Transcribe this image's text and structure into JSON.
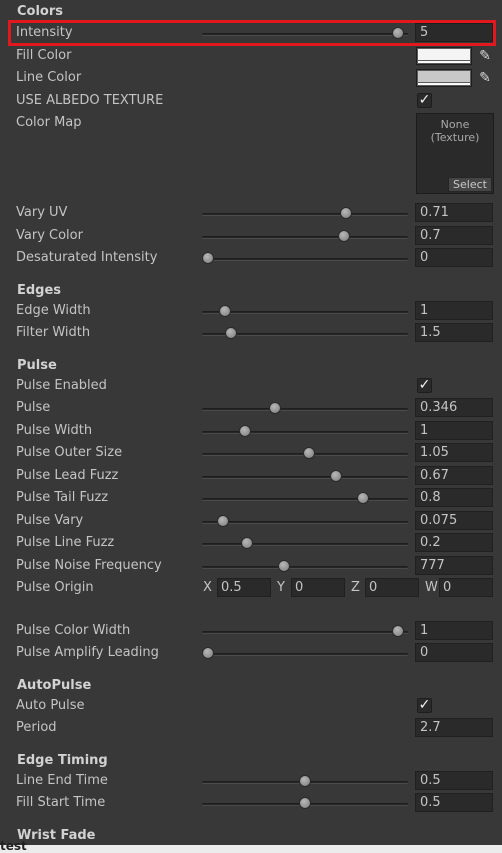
{
  "sections": {
    "colors": "Colors",
    "edges": "Edges",
    "pulse": "Pulse",
    "autopulse": "AutoPulse",
    "edge_timing": "Edge Timing",
    "wrist_fade": "Wrist Fade"
  },
  "colors": {
    "intensity": {
      "label": "Intensity",
      "value": "5",
      "fraction": 0.98
    },
    "fill_color": {
      "label": "Fill Color",
      "color": "#f4f4f4"
    },
    "line_color": {
      "label": "Line Color",
      "color": "#c8c8c8"
    },
    "use_albedo": {
      "label": "USE ALBEDO TEXTURE",
      "checked": "✓"
    },
    "color_map": {
      "label": "Color Map",
      "none_text": "None\n(Texture)",
      "select_label": "Select"
    },
    "vary_uv": {
      "label": "Vary UV",
      "value": "0.71",
      "fraction": 0.71
    },
    "vary_color": {
      "label": "Vary Color",
      "value": "0.7",
      "fraction": 0.7
    },
    "desaturated_intensity": {
      "label": "Desaturated Intensity",
      "value": "0",
      "fraction": 0.0
    }
  },
  "edges": {
    "edge_width": {
      "label": "Edge Width",
      "value": "1",
      "fraction": 0.09
    },
    "filter_width": {
      "label": "Filter Width",
      "value": "1.5",
      "fraction": 0.12
    }
  },
  "pulse": {
    "pulse_enabled": {
      "label": "Pulse Enabled",
      "checked": "✓"
    },
    "pulse": {
      "label": "Pulse",
      "value": "0.346",
      "fraction": 0.346
    },
    "pulse_width": {
      "label": "Pulse Width",
      "value": "1",
      "fraction": 0.19
    },
    "pulse_outer_size": {
      "label": "Pulse Outer Size",
      "value": "1.05",
      "fraction": 0.52
    },
    "pulse_lead_fuzz": {
      "label": "Pulse Lead Fuzz",
      "value": "0.67",
      "fraction": 0.66
    },
    "pulse_tail_fuzz": {
      "label": "Pulse Tail Fuzz",
      "value": "0.8",
      "fraction": 0.8
    },
    "pulse_vary": {
      "label": "Pulse Vary",
      "value": "0.075",
      "fraction": 0.075
    },
    "pulse_line_fuzz": {
      "label": "Pulse Line Fuzz",
      "value": "0.2",
      "fraction": 0.2
    },
    "pulse_noise_frequency": {
      "label": "Pulse Noise Frequency",
      "value": "777",
      "fraction": 0.39
    },
    "pulse_origin": {
      "label": "Pulse Origin",
      "x_label": "X",
      "x": "0.5",
      "y_label": "Y",
      "y": "0",
      "z_label": "Z",
      "z": "0",
      "w_label": "W",
      "w": "0"
    },
    "pulse_color_width": {
      "label": "Pulse Color Width",
      "value": "1",
      "fraction": 0.98
    },
    "pulse_amplify_leading": {
      "label": "Pulse Amplify Leading",
      "value": "0",
      "fraction": 0.0
    }
  },
  "autopulse": {
    "auto_pulse": {
      "label": "Auto Pulse",
      "checked": "✓"
    },
    "period": {
      "label": "Period",
      "value": "2.7"
    }
  },
  "edge_timing": {
    "line_end_time": {
      "label": "Line End Time",
      "value": "0.5",
      "fraction": 0.5
    },
    "fill_start_time": {
      "label": "Fill Start Time",
      "value": "0.5",
      "fraction": 0.5
    }
  },
  "bottom_text": "test"
}
